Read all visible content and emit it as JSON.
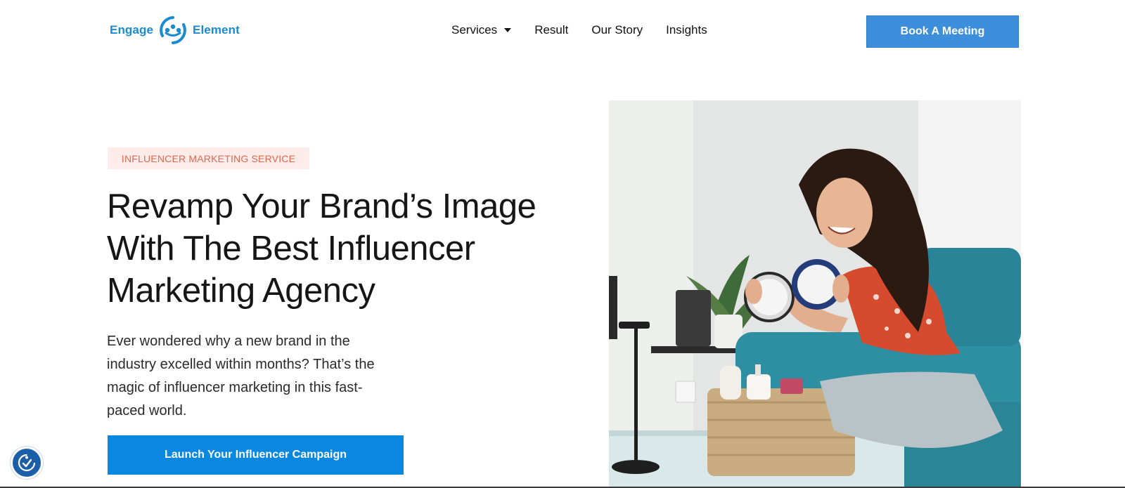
{
  "header": {
    "logo": {
      "left_word": "Engage",
      "right_word": "Element",
      "icon": "engage-element-logo-icon",
      "color": "#1a8bd1"
    },
    "nav": [
      {
        "label": "Services",
        "has_dropdown": true,
        "icon": "caret-down-icon"
      },
      {
        "label": "Result"
      },
      {
        "label": "Our Story"
      },
      {
        "label": "Insights"
      }
    ],
    "cta_label": "Book A Meeting",
    "cta_color": "#3d8fdc"
  },
  "hero": {
    "badge": "INFLUENCER MARKETING SERVICE",
    "badge_colors": {
      "background": "#fdecea",
      "text": "#e2684f"
    },
    "headline_lines": [
      "Revamp Your Brand’s Image",
      "With The Best Influencer",
      "Marketing Agency"
    ],
    "lede_lines": [
      "Ever wondered why a new brand in the",
      "industry excelled within months? That’s the",
      "magic of influencer marketing in this fast-",
      "paced world."
    ],
    "cta_label": "Launch Your Influencer Campaign",
    "cta_color": "#0a88e0",
    "image": "woman-with-mirrors-photo"
  },
  "accessibility_widget": {
    "icon": "accessibility-icon",
    "color": "#1b5fa8"
  }
}
